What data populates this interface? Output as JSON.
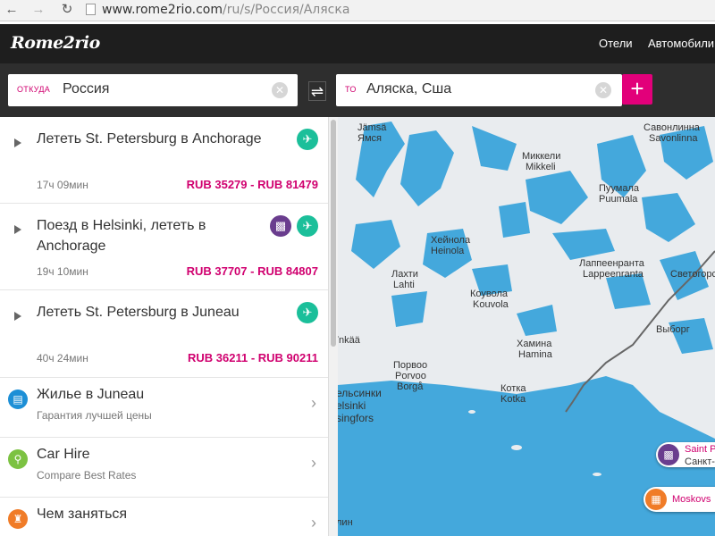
{
  "browser": {
    "back_icon": "arrow-left-icon",
    "forward_icon": "arrow-right-icon",
    "reload_icon": "reload-icon",
    "url_host": "www.rome2rio.com",
    "url_path": "/ru/s/Россия/Аляска"
  },
  "header": {
    "logo": "Rome2rio",
    "nav": [
      "Отели",
      "Автомобили"
    ]
  },
  "search": {
    "from_label": "ОТКУДА",
    "from_value": "Россия",
    "to_label": "ТО",
    "to_value": "Аляска, Сша",
    "clear_icon": "close-icon",
    "swap_icon": "swap-icon",
    "add_icon": "plus-icon"
  },
  "routes": [
    {
      "title": "Лететь St. Petersburg в Anchorage",
      "duration": "17ч 09мин",
      "price": "RUB 35279 - RUB 81479",
      "icons": [
        "plane-icon"
      ]
    },
    {
      "title": "Поезд в Helsinki, лететь в Anchorage",
      "duration": "19ч 10мин",
      "price": "RUB 37707 - RUB 84807",
      "icons": [
        "train-icon",
        "plane-icon"
      ]
    },
    {
      "title": "Лететь St. Petersburg в Juneau",
      "duration": "40ч 24мин",
      "price": "RUB 36211 - RUB 90211",
      "icons": [
        "plane-icon"
      ]
    }
  ],
  "services": [
    {
      "title": "Жилье в Juneau",
      "subtitle": "Гарантия лучшей цены",
      "icon": "bed-icon",
      "color": "#1d8fd6"
    },
    {
      "title": "Car Hire",
      "subtitle": "Compare Best Rates",
      "icon": "key-icon",
      "color": "#7cc242"
    },
    {
      "title": "Чем заняться",
      "subtitle": "",
      "icon": "castle-icon",
      "color": "#f07c28"
    }
  ],
  "map": {
    "labels": [
      {
        "text": "Jämsä"
      },
      {
        "text": "Ямся"
      },
      {
        "text": "Миккели"
      },
      {
        "text": "Mikkeli"
      },
      {
        "text": "Савонлинна"
      },
      {
        "text": "Savonlinna"
      },
      {
        "text": "Пуумала"
      },
      {
        "text": "Puumala"
      },
      {
        "text": "Хейнола"
      },
      {
        "text": "Heinola"
      },
      {
        "text": "Лахти"
      },
      {
        "text": "Lahti"
      },
      {
        "text": "Коувола"
      },
      {
        "text": "Kouvola"
      },
      {
        "text": "Лаппеенранта"
      },
      {
        "text": "Lappeenranta"
      },
      {
        "text": "Светогорск"
      },
      {
        "text": "Хамина"
      },
      {
        "text": "Hamina"
      },
      {
        "text": "Выборг"
      },
      {
        "text": "Порвоо"
      },
      {
        "text": "Porvoo"
      },
      {
        "text": "Borgå"
      },
      {
        "text": "Котка"
      },
      {
        "text": "Kotka"
      },
      {
        "text": "ельсинки"
      },
      {
        "text": "elsinki"
      },
      {
        "text": "singfors"
      },
      {
        "text": "ïnkää"
      },
      {
        "text": "лин"
      }
    ],
    "pins": [
      {
        "text": "Saint P",
        "sub": "Санкт-Бо",
        "icon": "train-icon",
        "color": "#6a3d8e"
      },
      {
        "text": "Moskovs",
        "icon": "bus-icon",
        "color": "#f07c28"
      }
    ],
    "colors": {
      "water": "#44a8dc",
      "land": "#e9ecef",
      "route": "#666666"
    }
  }
}
